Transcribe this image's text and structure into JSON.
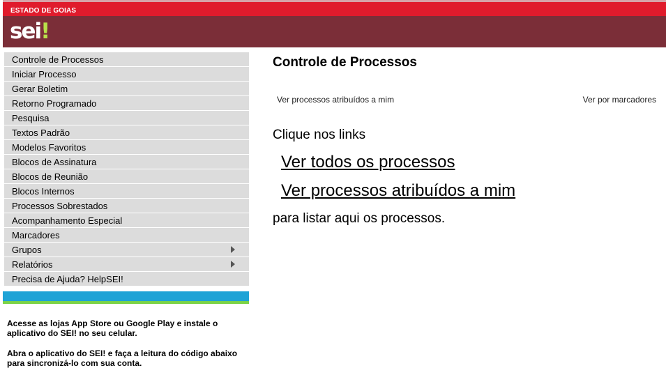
{
  "header": {
    "state_label": "ESTADO DE GOIAS",
    "logo_text": "sei",
    "logo_bang": "!"
  },
  "menu": {
    "items": [
      {
        "label": "Controle de Processos"
      },
      {
        "label": "Iniciar Processo"
      },
      {
        "label": "Gerar Boletim"
      },
      {
        "label": "Retorno Programado"
      },
      {
        "label": "Pesquisa"
      },
      {
        "label": "Textos Padrão"
      },
      {
        "label": "Modelos Favoritos"
      },
      {
        "label": "Blocos de Assinatura"
      },
      {
        "label": "Blocos de Reunião"
      },
      {
        "label": "Blocos Internos"
      },
      {
        "label": "Processos Sobrestados"
      },
      {
        "label": "Acompanhamento Especial"
      },
      {
        "label": "Marcadores"
      },
      {
        "label": "Grupos"
      },
      {
        "label": "Relatórios"
      },
      {
        "label": "Precisa de Ajuda? HelpSEI!"
      }
    ]
  },
  "app_promo": {
    "line1": "Acesse as lojas App Store ou Google Play e instale o aplicativo do SEI! no seu celular.",
    "line2": "Abra o aplicativo do SEI! e faça a leitura do código abaixo para sincronizá-lo com sua conta."
  },
  "main": {
    "title": "Controle de Processos",
    "link_assigned_small": "Ver processos atribuídos a mim",
    "link_markers": "Ver por marcadores",
    "intro": "Clique nos links",
    "link_all": "Ver todos os processos",
    "link_assigned": "Ver processos atribuídos a mim",
    "outro": "para listar aqui os processos."
  },
  "colors": {
    "top_red": "#e01b2c",
    "brand_maroon": "#7b2e38",
    "menu_gray": "#dcdcdc",
    "stripe_blue": "#1ea3d6",
    "stripe_green": "#7cd347"
  }
}
